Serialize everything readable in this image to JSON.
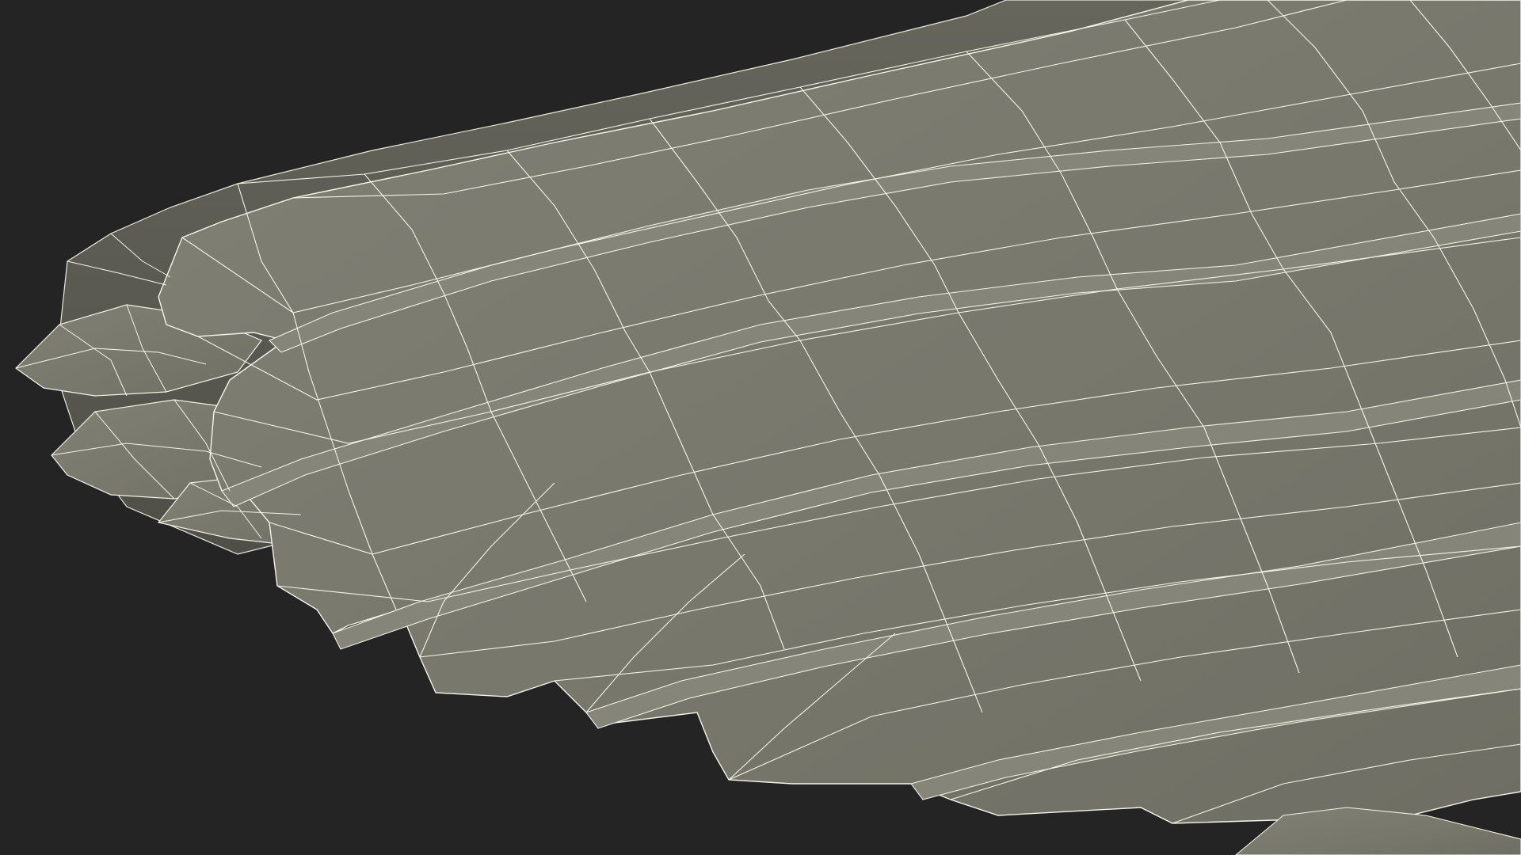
{
  "scene": {
    "subject": "wing-wireframe-render",
    "colors": {
      "background": "#242424",
      "surface": "#7a7a6e",
      "surface_dark": "#5e5e55",
      "surface_shadow": "#4a4a44",
      "wire": "#f2f2e6"
    }
  }
}
